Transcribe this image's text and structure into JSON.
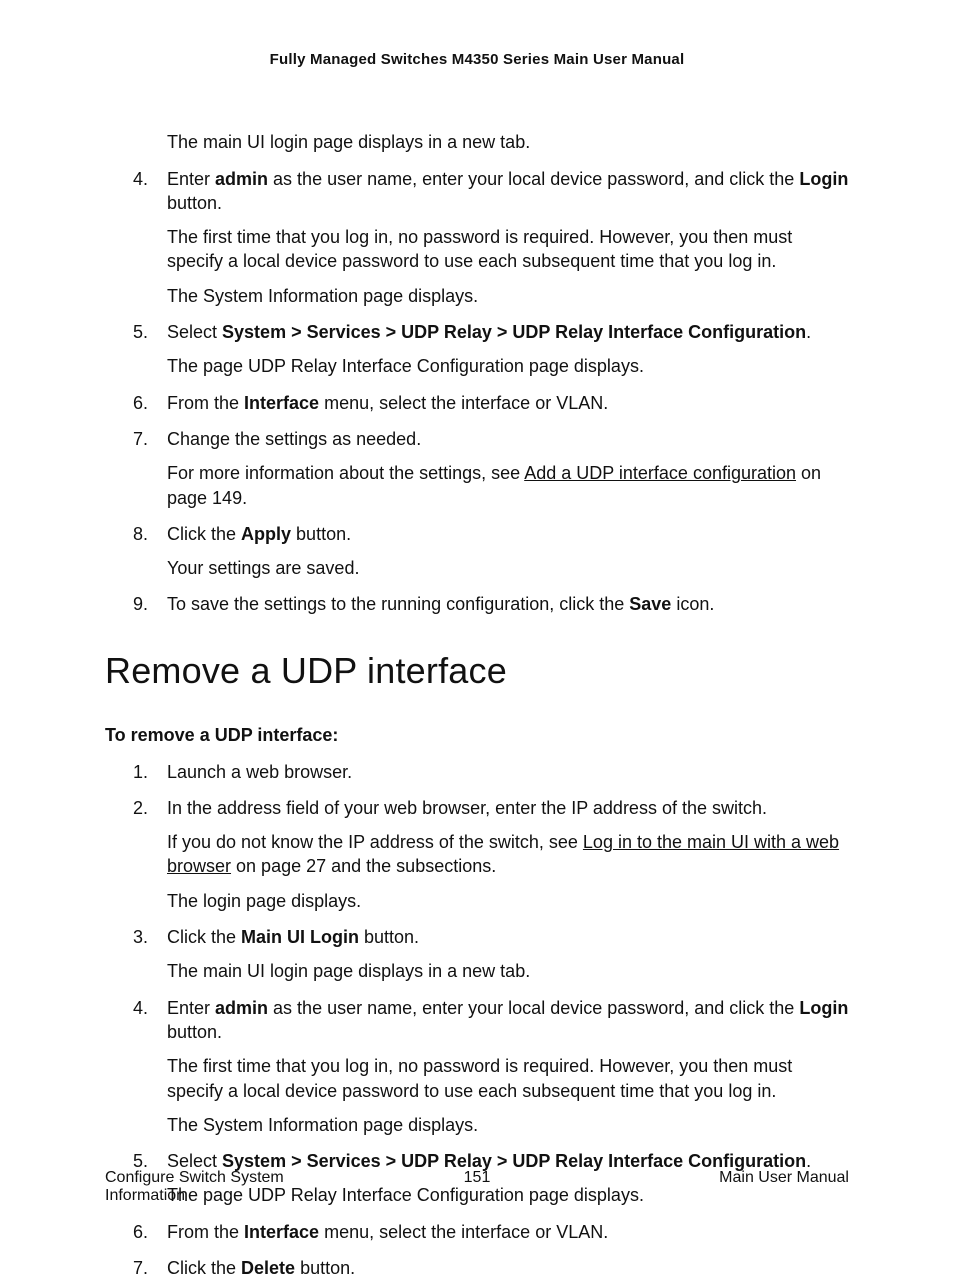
{
  "header": "Fully Managed Switches M4350 Series Main User Manual",
  "top_indent": "The main UI login page displays in a new tab.",
  "steps_a": {
    "s4": {
      "num": "4.",
      "line1_a": "Enter ",
      "line1_b": "admin",
      "line1_c": " as the user name, enter your local device password, and click the ",
      "line1_d": "Login",
      "line1_e": " button.",
      "line2": "The first time that you log in, no password is required. However, you then must specify a local device password to use each subsequent time that you log in.",
      "line3": "The System Information page displays."
    },
    "s5": {
      "num": "5.",
      "line1_a": "Select ",
      "line1_b": "System > Services > UDP Relay > UDP Relay Interface Configuration",
      "line1_c": ".",
      "line2": "The page UDP Relay Interface Configuration page displays."
    },
    "s6": {
      "num": "6.",
      "line1_a": "From the ",
      "line1_b": "Interface",
      "line1_c": " menu, select the interface or VLAN."
    },
    "s7": {
      "num": "7.",
      "line1": "Change the settings as needed.",
      "line2_a": "For more information about the settings, see ",
      "line2_link": "Add a UDP interface configuration",
      "line2_b": " on page 149."
    },
    "s8": {
      "num": "8.",
      "line1_a": "Click the ",
      "line1_b": "Apply",
      "line1_c": " button.",
      "line2": "Your settings are saved."
    },
    "s9": {
      "num": "9.",
      "line1_a": "To save the settings to the running configuration, click the ",
      "line1_b": "Save",
      "line1_c": " icon."
    }
  },
  "section_title": "Remove a UDP interface",
  "intro_b": "To remove a UDP interface:",
  "steps_b": {
    "s1": {
      "num": "1.",
      "line1": "Launch a web browser."
    },
    "s2": {
      "num": "2.",
      "line1": "In the address field of your web browser, enter the IP address of the switch.",
      "line2_a": "If you do not know the IP address of the switch, see ",
      "line2_link": "Log in to the main UI with a web browser",
      "line2_b": " on page 27 and the subsections.",
      "line3": "The login page displays."
    },
    "s3": {
      "num": "3.",
      "line1_a": "Click the ",
      "line1_b": "Main UI Login",
      "line1_c": " button.",
      "line2": "The main UI login page displays in a new tab."
    },
    "s4": {
      "num": "4.",
      "line1_a": "Enter ",
      "line1_b": "admin",
      "line1_c": " as the user name, enter your local device password, and click the ",
      "line1_d": "Login",
      "line1_e": " button.",
      "line2": "The first time that you log in, no password is required. However, you then must specify a local device password to use each subsequent time that you log in.",
      "line3": "The System Information page displays."
    },
    "s5": {
      "num": "5.",
      "line1_a": "Select ",
      "line1_b": "System > Services > UDP Relay > UDP Relay Interface Configuration",
      "line1_c": ".",
      "line2": "The page UDP Relay Interface Configuration page displays."
    },
    "s6": {
      "num": "6.",
      "line1_a": "From the ",
      "line1_b": "Interface",
      "line1_c": " menu, select the interface or VLAN."
    },
    "s7": {
      "num": "7.",
      "line1_a": "Click the ",
      "line1_b": "Delete",
      "line1_c": " button."
    }
  },
  "footer": {
    "left": "Configure Switch System Information",
    "center": "151",
    "right": "Main User Manual"
  }
}
